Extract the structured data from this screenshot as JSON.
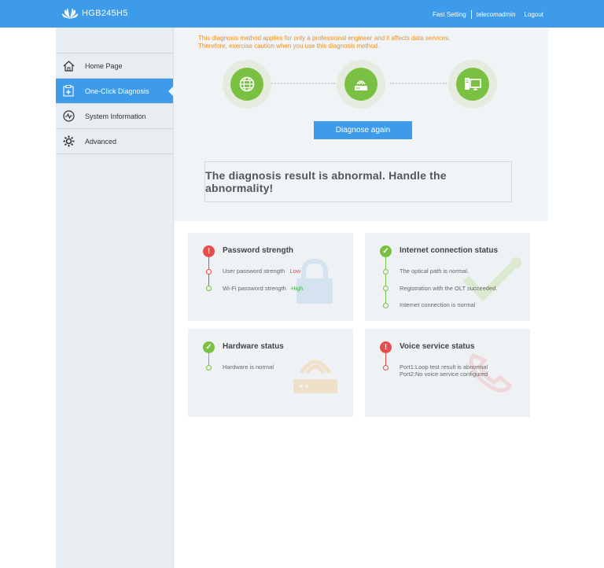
{
  "header": {
    "logo_text": "HGB245H5",
    "fast_setting": "Fast Setting",
    "user": "telecomadmin",
    "logout": "Logout",
    "bg_color": "#3d9be9"
  },
  "sidebar": {
    "items": [
      {
        "label": "Home Page",
        "icon": "home-icon"
      },
      {
        "label": "One-Click Diagnosis",
        "icon": "diagnosis-icon",
        "active": true
      },
      {
        "label": "System Information",
        "icon": "pulse-icon"
      },
      {
        "label": "Advanced",
        "icon": "gear-icon"
      }
    ]
  },
  "diagnosis": {
    "warning_line1": "This diagnosis method applies for only a professional engineer and it affects data services.",
    "warning_line2": "Therefore, exercise caution when you use this diagnosis method.",
    "nodes": [
      "globe-icon",
      "router-icon",
      "computer-icon"
    ],
    "button_label": "Diagnose again",
    "result_text": "The diagnosis result is abnormal. Handle the abnormality!"
  },
  "cards": {
    "password": {
      "title": "Password strength",
      "status": "abnormal",
      "user_label": "User password strength",
      "user_value": "Low",
      "wifi_label": "Wi-Fi password strength",
      "wifi_value": "High"
    },
    "internet": {
      "title": "Internet connection status",
      "status": "normal",
      "items": [
        "The optical path is normal.",
        "Registration with the OLT succeeded.",
        "Internet connection is normal"
      ]
    },
    "hardware": {
      "title": "Hardware status",
      "status": "normal",
      "items": [
        "Hardware is normal"
      ]
    },
    "voice": {
      "title": "Voice service status",
      "status": "abnormal",
      "items": [
        "Port1:Loop test result is abnormal",
        "Port2:No voice service configured"
      ]
    }
  },
  "colors": {
    "accent": "#3d9be9",
    "ok": "#7ac143",
    "error": "#e84d4d",
    "warning": "#ef8d1c"
  }
}
